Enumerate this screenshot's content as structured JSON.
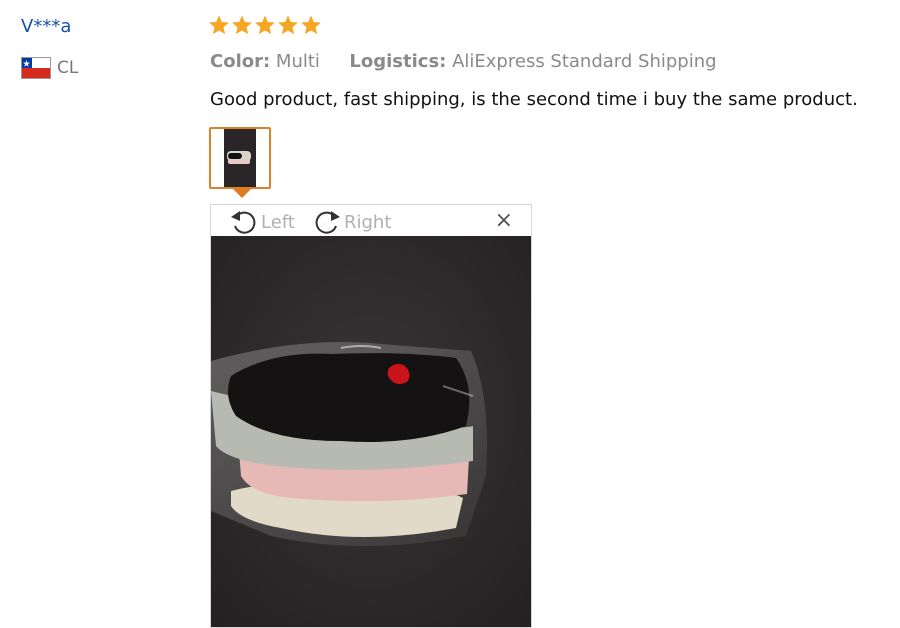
{
  "reviewer": {
    "name": "V***a",
    "country_code": "CL"
  },
  "rating": {
    "stars": 5,
    "max": 5,
    "star_color": "#f5a623"
  },
  "meta": {
    "color_label": "Color:",
    "color_value": "Multi",
    "logistics_label": "Logistics:",
    "logistics_value": "AliExpress Standard Shipping"
  },
  "review_text": "Good product, fast shipping, is the second time i buy the same product.",
  "viewer": {
    "rotate_left": "Left",
    "rotate_right": "Right",
    "close_symbol": "×"
  },
  "colors": {
    "accent": "#e07a1f",
    "username": "#1a4fa8"
  }
}
